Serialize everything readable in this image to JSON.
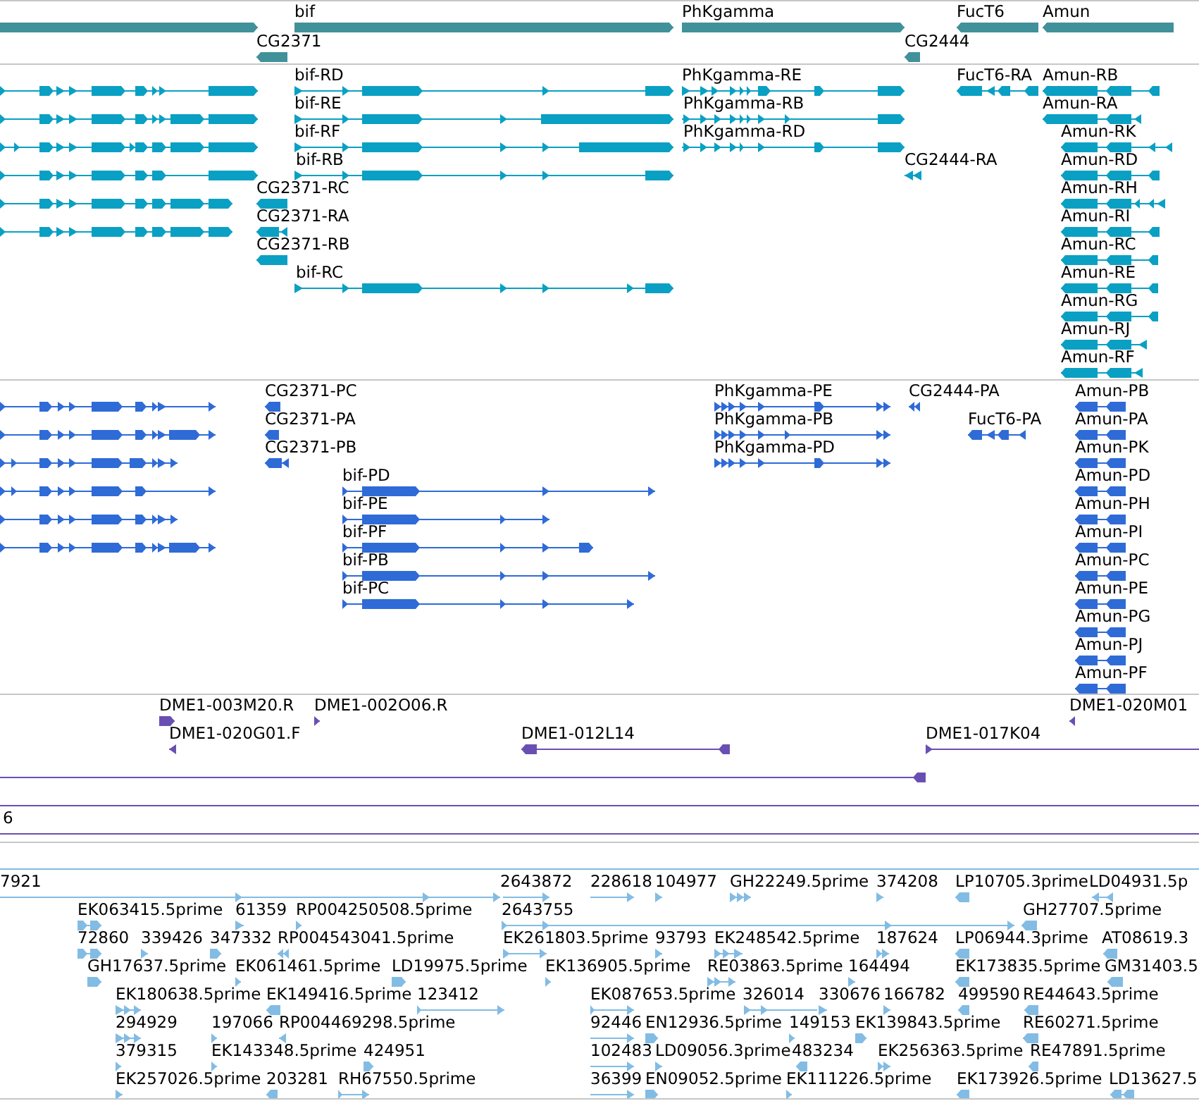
{
  "tracks": [
    {
      "features": [
        {
          "reverse": false
        },
        {
          "label": "bif",
          "reverse": false
        },
        {
          "label": "PhKgamma",
          "reverse": false
        },
        {
          "label": "FucT6",
          "reverse": true
        },
        {
          "label": "Amun",
          "reverse": true
        },
        {
          "label": "CG2371",
          "reverse": true
        },
        {
          "label": "CG2444",
          "reverse": true
        }
      ]
    },
    {
      "features": [
        {
          "reverse": false
        },
        {
          "label": "bif-RD",
          "reverse": false
        },
        {
          "label": "PhKgamma-RE",
          "reverse": false
        },
        {
          "label": "FucT6-RA",
          "reverse": true
        },
        {
          "label": "Amun-RB",
          "reverse": true
        },
        {
          "reverse": false
        },
        {
          "label": "bif-RE",
          "reverse": false
        },
        {
          "label": "PhKgamma-RB",
          "reverse": false
        },
        {
          "label": "Amun-RA",
          "reverse": true
        },
        {
          "reverse": false
        },
        {
          "label": "bif-RF",
          "reverse": false
        },
        {
          "label": "PhKgamma-RD",
          "reverse": false
        },
        {
          "label": "Amun-RK",
          "reverse": true
        },
        {
          "reverse": false
        },
        {
          "label": "bif-RB",
          "reverse": false
        },
        {
          "label": "CG2444-RA",
          "reverse": true
        },
        {
          "label": "Amun-RD",
          "reverse": true
        },
        {
          "reverse": false
        },
        {
          "label": "CG2371-RC",
          "reverse": true
        },
        {
          "label": "Amun-RH",
          "reverse": true
        },
        {
          "reverse": false
        },
        {
          "label": "CG2371-RA",
          "reverse": true
        },
        {
          "label": "Amun-RI",
          "reverse": true
        },
        {
          "label": "CG2371-RB",
          "reverse": true
        },
        {
          "label": "Amun-RC",
          "reverse": true
        },
        {
          "label": "bif-RC",
          "reverse": false
        },
        {
          "label": "Amun-RE",
          "reverse": true
        },
        {
          "label": "Amun-RG",
          "reverse": true
        },
        {
          "label": "Amun-RJ",
          "reverse": true
        },
        {
          "label": "Amun-RF",
          "reverse": true
        }
      ]
    },
    {
      "features": [
        {
          "reverse": false
        },
        {
          "label": "CG2371-PC",
          "reverse": true
        },
        {
          "label": "PhKgamma-PE",
          "reverse": false
        },
        {
          "label": "CG2444-PA",
          "reverse": true
        },
        {
          "label": "Amun-PB",
          "reverse": true
        },
        {
          "reverse": false
        },
        {
          "label": "CG2371-PA",
          "reverse": true
        },
        {
          "label": "PhKgamma-PB",
          "reverse": false
        },
        {
          "label": "FucT6-PA",
          "reverse": true
        },
        {
          "label": "Amun-PA",
          "reverse": true
        },
        {
          "reverse": false
        },
        {
          "label": "CG2371-PB",
          "reverse": true
        },
        {
          "label": "PhKgamma-PD",
          "reverse": false
        },
        {
          "label": "Amun-PK",
          "reverse": true
        },
        {
          "reverse": false
        },
        {
          "label": "bif-PD",
          "reverse": false
        },
        {
          "label": "Amun-PD",
          "reverse": true
        },
        {
          "reverse": false
        },
        {
          "label": "bif-PE",
          "reverse": false
        },
        {
          "label": "Amun-PH",
          "reverse": true
        },
        {
          "reverse": false
        },
        {
          "label": "bif-PF",
          "reverse": false
        },
        {
          "label": "Amun-PI",
          "reverse": true
        },
        {
          "label": "bif-PB",
          "reverse": false
        },
        {
          "label": "Amun-PC",
          "reverse": true
        },
        {
          "label": "bif-PC",
          "reverse": false
        },
        {
          "label": "Amun-PE",
          "reverse": true
        },
        {
          "label": "Amun-PG",
          "reverse": true
        },
        {
          "label": "Amun-PJ",
          "reverse": true
        },
        {
          "label": "Amun-PF",
          "reverse": true
        }
      ]
    },
    {
      "features": [
        {
          "label": "DME1-003M20.R",
          "reverse": false
        },
        {
          "label": "DME1-002O06.R",
          "reverse": false
        },
        {
          "label": "DME1-020M01",
          "reverse": true
        },
        {
          "label": "DME1-020G01.F",
          "reverse": true
        },
        {
          "label": "DME1-012L14",
          "reverse": true
        },
        {
          "label": "DME1-017K04",
          "reverse": false
        },
        {
          "reverse": true
        },
        {
          "label": "6"
        }
      ]
    },
    {
      "features": [
        {
          "label": "7921",
          "reverse": false
        },
        {
          "label": "2643872",
          "reverse": false
        },
        {
          "label": "228618",
          "reverse": false
        },
        {
          "label": "104977",
          "reverse": false
        },
        {
          "label": "GH22249.5prime",
          "reverse": false
        },
        {
          "label": "374208",
          "reverse": false
        },
        {
          "label": "LP10705.3prime",
          "reverse": true
        },
        {
          "label": "LD04931.5p",
          "reverse": true
        },
        {
          "label": "EK063415.5prime",
          "reverse": false
        },
        {
          "label": "61359",
          "reverse": false
        },
        {
          "label": "RP004250508.5prime",
          "reverse": false
        },
        {
          "label": "2643755",
          "reverse": false
        },
        {
          "label": "GH27707.5prime",
          "reverse": true
        },
        {
          "label": "72860",
          "reverse": false
        },
        {
          "label": "339426",
          "reverse": false
        },
        {
          "label": "347332",
          "reverse": false
        },
        {
          "label": "RP004543041.5prime",
          "reverse": true
        },
        {
          "label": "EK261803.5prime",
          "reverse": false
        },
        {
          "label": "93793",
          "reverse": false
        },
        {
          "label": "EK248542.5prime",
          "reverse": false
        },
        {
          "label": "187624",
          "reverse": false
        },
        {
          "label": "LP06944.3prime",
          "reverse": true
        },
        {
          "label": "AT08619.3",
          "reverse": true
        },
        {
          "label": "GH17637.5prime",
          "reverse": false
        },
        {
          "label": "EK061461.5prime",
          "reverse": false
        },
        {
          "label": "LD19975.5prime",
          "reverse": false
        },
        {
          "label": "EK136905.5prime",
          "reverse": false
        },
        {
          "label": "RE03863.5prime",
          "reverse": false
        },
        {
          "label": "164494",
          "reverse": false
        },
        {
          "label": "EK173835.5prime",
          "reverse": true
        },
        {
          "label": "GM31403.5",
          "reverse": true
        },
        {
          "label": "EK180638.5prime",
          "reverse": false
        },
        {
          "label": "EK149416.5prime",
          "reverse": true
        },
        {
          "label": "123412",
          "reverse": false
        },
        {
          "label": "EK087653.5prime",
          "reverse": false
        },
        {
          "label": "326014",
          "reverse": false
        },
        {
          "label": "330676",
          "reverse": false
        },
        {
          "label": "166782",
          "reverse": false
        },
        {
          "label": "499590",
          "reverse": true
        },
        {
          "label": "RE44643.5prime",
          "reverse": true
        },
        {
          "label": "294929",
          "reverse": false
        },
        {
          "label": "197066",
          "reverse": false
        },
        {
          "label": "RP004469298.5prime",
          "reverse": true
        },
        {
          "label": "92446",
          "reverse": false
        },
        {
          "label": "EN12936.5prime",
          "reverse": false
        },
        {
          "label": "149153",
          "reverse": false
        },
        {
          "label": "EK139843.5prime",
          "reverse": false
        },
        {
          "label": "RE60271.5prime",
          "reverse": true
        },
        {
          "label": "379315",
          "reverse": false
        },
        {
          "label": "EK143348.5prime",
          "reverse": false
        },
        {
          "label": "424951",
          "reverse": false
        },
        {
          "label": "102483",
          "reverse": false
        },
        {
          "label": "LD09056.3prime",
          "reverse": false
        },
        {
          "label": "483234",
          "reverse": true
        },
        {
          "label": "EK256363.5prime",
          "reverse": false
        },
        {
          "label": "RE47891.5prime",
          "reverse": true
        },
        {
          "label": "EK257026.5prime",
          "reverse": false
        },
        {
          "label": "203281",
          "reverse": true
        },
        {
          "label": "RH67550.5prime",
          "reverse": false
        },
        {
          "label": "36399",
          "reverse": false
        },
        {
          "label": "EN09052.5prime",
          "reverse": false
        },
        {
          "label": "EK111226.5prime",
          "reverse": false
        },
        {
          "label": "EK173926.5prime",
          "reverse": true
        },
        {
          "label": "LD13627.5",
          "reverse": true
        }
      ]
    }
  ]
}
